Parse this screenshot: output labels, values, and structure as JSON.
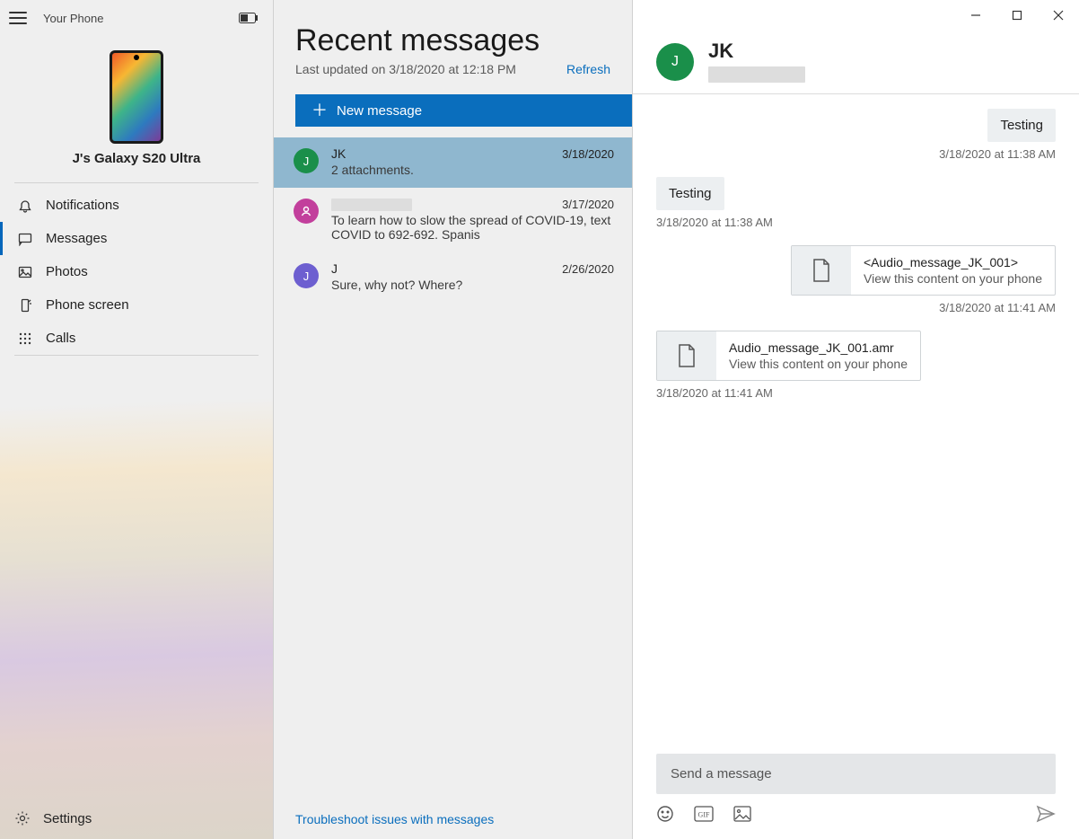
{
  "app": {
    "title": "Your Phone",
    "device_name": "J's Galaxy S20 Ultra"
  },
  "sidebar": {
    "items": [
      {
        "label": "Notifications"
      },
      {
        "label": "Messages"
      },
      {
        "label": "Photos"
      },
      {
        "label": "Phone screen"
      },
      {
        "label": "Calls"
      }
    ],
    "settings_label": "Settings"
  },
  "messages_pane": {
    "heading": "Recent messages",
    "last_updated": "Last updated on 3/18/2020 at 12:18 PM",
    "refresh_label": "Refresh",
    "new_message_label": "New message",
    "troubleshoot_label": "Troubleshoot issues with messages",
    "conversations": [
      {
        "avatar_initial": "J",
        "avatar_color": "green",
        "name": "JK",
        "preview": "2 attachments.",
        "date": "3/18/2020",
        "selected": true,
        "redacted": false
      },
      {
        "avatar_initial": "",
        "avatar_color": "pink",
        "name": "",
        "preview": "To learn how to slow the spread of COVID-19, text COVID to 692-692. Spanis",
        "date": "3/17/2020",
        "selected": false,
        "redacted": true
      },
      {
        "avatar_initial": "J",
        "avatar_color": "purple",
        "name": "J",
        "preview": "Sure, why not? Where?",
        "date": "2/26/2020",
        "selected": false,
        "redacted": false
      }
    ]
  },
  "chat": {
    "contact_initial": "J",
    "contact_name": "JK",
    "messages": [
      {
        "side": "sent",
        "type": "text",
        "text": "Testing",
        "time": "3/18/2020 at 11:38 AM"
      },
      {
        "side": "recv",
        "type": "text",
        "text": "Testing",
        "time": "3/18/2020 at 11:38 AM"
      },
      {
        "side": "sent",
        "type": "attachment",
        "title": "<Audio_message_JK_001>",
        "subtitle": "View this content on your phone",
        "time": "3/18/2020 at 11:41 AM"
      },
      {
        "side": "recv",
        "type": "attachment",
        "title": "Audio_message_JK_001.amr",
        "subtitle": "View this content on your phone",
        "time": "3/18/2020 at 11:41 AM"
      }
    ],
    "composer_placeholder": "Send a message"
  }
}
